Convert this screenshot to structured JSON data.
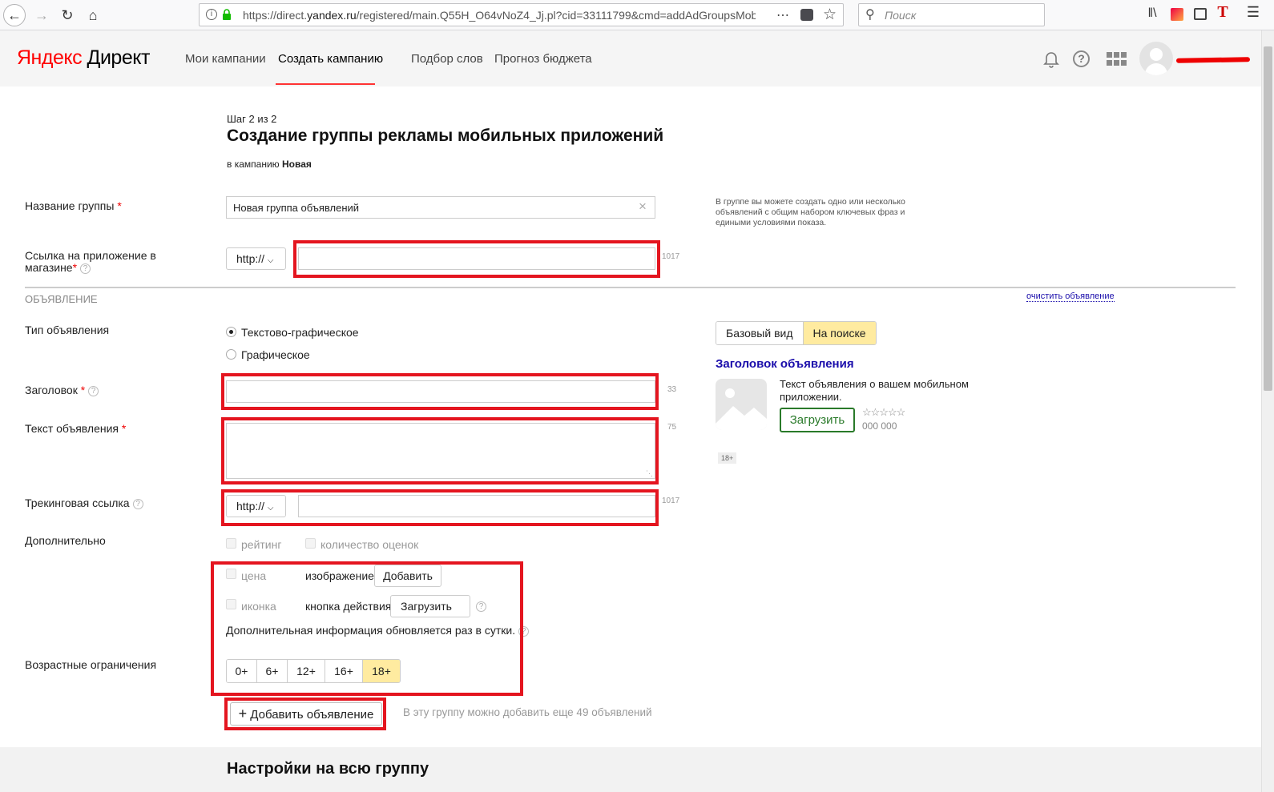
{
  "browser": {
    "url_prefix": "https://direct.",
    "url_domain": "yandex.ru",
    "url_rest": "/registered/main.Q55H_O64vNoZ4_Jj.pl?cid=33111799&cmd=addAdGroupsMob",
    "search_placeholder": "Поиск"
  },
  "header": {
    "logo_yandex": "Яндекс",
    "logo_product": "Директ",
    "nav": [
      "Мои кампании",
      "Создать кампанию",
      "Подбор слов",
      "Прогноз бюджета"
    ],
    "active_nav": "Создать кампанию"
  },
  "page": {
    "step": "Шаг 2 из 2",
    "title": "Создание группы рекламы мобильных приложений",
    "campaign_prefix": "в кампанию",
    "campaign_name": "Новая"
  },
  "form": {
    "group_name_label": "Название группы",
    "group_name_value": "Новая группа объявлений",
    "group_hint": "В группе вы можете создать одно или несколько объявлений с общим набором ключевых фраз и едиными условиями показа.",
    "app_link_label_1": "Ссылка на приложение в",
    "app_link_label_2": "магазине",
    "protocol": "http://",
    "app_link_counter": "1017",
    "ad_section": "ОБЪЯВЛЕНИЕ",
    "clear_ad": "очистить объявление",
    "ad_type_label": "Тип объявления",
    "ad_type_options": [
      "Текстово-графическое",
      "Графическое"
    ],
    "headline_label": "Заголовок",
    "headline_counter": "33",
    "text_label": "Текст объявления",
    "text_counter": "75",
    "tracking_label": "Трекинговая ссылка",
    "tracking_counter": "1017",
    "extra_label": "Дополнительно",
    "extras": {
      "rating": "рейтинг",
      "ratings_count": "количество оценок",
      "price": "цена",
      "icon": "иконка",
      "image_label": "изображение",
      "image_button": "Добавить",
      "action_label": "кнопка действия",
      "action_value": "Загрузить",
      "info_note": "Дополнительная информация обновляется раз в сутки."
    },
    "age_label": "Возрастные ограничения",
    "age_options": [
      "0+",
      "6+",
      "12+",
      "16+",
      "18+"
    ],
    "age_selected": "18+",
    "add_ad_button": "Добавить объявление",
    "add_ad_note": "В эту группу можно добавить еще 49 объявлений",
    "group_settings_title": "Настройки на всю группу"
  },
  "preview": {
    "tabs": [
      "Базовый вид",
      "На поиске"
    ],
    "active_tab": "На поиске",
    "headline": "Заголовок объявления",
    "text": "Текст объявления о вашем мобильном приложении.",
    "install_button": "Загрузить",
    "stars": "☆☆☆☆☆",
    "downloads": "000 000",
    "age_badge": "18+"
  },
  "colors": {
    "yandex_red": "#ff0000",
    "highlight_red": "#e4151f",
    "link_blue": "#1a0dab",
    "active_yellow": "#ffeba0",
    "install_green": "#2a7a2a"
  }
}
